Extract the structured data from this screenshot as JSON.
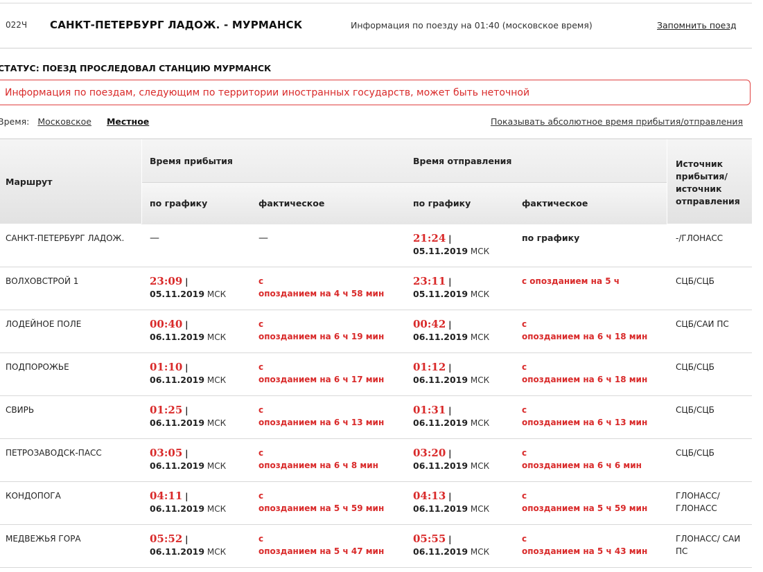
{
  "header": {
    "train_number": "022Ч",
    "route": "САНКТ-ПЕТЕРБУРГ ЛАДОЖ. - МУРМАНСК",
    "info": "Информация по поезду на 01:40 (московское время)",
    "remember": "Запомнить поезд"
  },
  "status": "СТАТУС: ПОЕЗД ПРОСЛЕДОВАЛ СТАНЦИЮ МУРМАНСК",
  "warning": "Информация по поездам, следующим по территории иностранных государств, может быть неточной",
  "time_selector": {
    "label": "Время:",
    "options": [
      "Московское",
      "Местное"
    ],
    "selected": "Местное",
    "absolute_link": "Показывать абсолютное время прибытия/отправления"
  },
  "table": {
    "col_route": "Маршрут",
    "col_arrival": "Время прибытия",
    "col_departure": "Время отправления",
    "col_source": "Источник прибытия/ источник отправления",
    "sub_scheduled": "по графику",
    "sub_actual": "фактическое",
    "rows": [
      {
        "station": "САНКТ-ПЕТЕРБУРГ ЛАДОЖ.",
        "arr_time": "—",
        "arr_date": "",
        "arr_tz": "",
        "arr_actual_1": "—",
        "arr_actual_2": "",
        "dep_time": "21:24",
        "dep_date": "05.11.2019",
        "dep_tz": "МСК",
        "dep_actual_1": "по графику",
        "dep_actual_2": "",
        "source": "-/ГЛОНАСС"
      },
      {
        "station": "ВОЛХОВСТРОЙ 1",
        "arr_time": "23:09",
        "arr_date": "05.11.2019",
        "arr_tz": "МСК",
        "arr_actual_1": "с",
        "arr_actual_2": "опозданием на 4 ч 58 мин",
        "dep_time": "23:11",
        "dep_date": "05.11.2019",
        "dep_tz": "МСК",
        "dep_actual_1": "с опозданием на 5 ч",
        "dep_actual_2": "",
        "source": "СЦБ/СЦБ"
      },
      {
        "station": "ЛОДЕЙНОЕ ПОЛЕ",
        "arr_time": "00:40",
        "arr_date": "06.11.2019",
        "arr_tz": "МСК",
        "arr_actual_1": "с",
        "arr_actual_2": "опозданием на 6 ч 19 мин",
        "dep_time": "00:42",
        "dep_date": "06.11.2019",
        "dep_tz": "МСК",
        "dep_actual_1": "с",
        "dep_actual_2": "опозданием на 6 ч 18 мин",
        "source": "СЦБ/САИ ПС"
      },
      {
        "station": "ПОДПОРОЖЬЕ",
        "arr_time": "01:10",
        "arr_date": "06.11.2019",
        "arr_tz": "МСК",
        "arr_actual_1": "с",
        "arr_actual_2": "опозданием на 6 ч 17 мин",
        "dep_time": "01:12",
        "dep_date": "06.11.2019",
        "dep_tz": "МСК",
        "dep_actual_1": "с",
        "dep_actual_2": "опозданием на 6 ч 18 мин",
        "source": "СЦБ/СЦБ"
      },
      {
        "station": "СВИРЬ",
        "arr_time": "01:25",
        "arr_date": "06.11.2019",
        "arr_tz": "МСК",
        "arr_actual_1": "с",
        "arr_actual_2": "опозданием на 6 ч 13 мин",
        "dep_time": "01:31",
        "dep_date": "06.11.2019",
        "dep_tz": "МСК",
        "dep_actual_1": "с",
        "dep_actual_2": "опозданием на 6 ч 13 мин",
        "source": "СЦБ/СЦБ"
      },
      {
        "station": "ПЕТРОЗАВОДСК-ПАСС",
        "arr_time": "03:05",
        "arr_date": "06.11.2019",
        "arr_tz": "МСК",
        "arr_actual_1": "с",
        "arr_actual_2": "опозданием на 6 ч 8 мин",
        "dep_time": "03:20",
        "dep_date": "06.11.2019",
        "dep_tz": "МСК",
        "dep_actual_1": "с",
        "dep_actual_2": "опозданием на 6 ч 6 мин",
        "source": "СЦБ/СЦБ"
      },
      {
        "station": "КОНДОПОГА",
        "arr_time": "04:11",
        "arr_date": "06.11.2019",
        "arr_tz": "МСК",
        "arr_actual_1": "с",
        "arr_actual_2": "опозданием на 5 ч 59 мин",
        "dep_time": "04:13",
        "dep_date": "06.11.2019",
        "dep_tz": "МСК",
        "dep_actual_1": "с",
        "dep_actual_2": "опозданием на 5 ч 59 мин",
        "source": "ГЛОНАСС/ ГЛОНАСС"
      },
      {
        "station": "МЕДВЕЖЬЯ ГОРА",
        "arr_time": "05:52",
        "arr_date": "06.11.2019",
        "arr_tz": "МСК",
        "arr_actual_1": "с",
        "arr_actual_2": "опозданием на 5 ч 47 мин",
        "dep_time": "05:55",
        "dep_date": "06.11.2019",
        "dep_tz": "МСК",
        "dep_actual_1": "с",
        "dep_actual_2": "опозданием на 5 ч 43 мин",
        "source": "ГЛОНАСС/ САИ ПС"
      }
    ]
  },
  "colors": {
    "accent_red": "#d92a2a",
    "warning_border": "#e04040"
  }
}
